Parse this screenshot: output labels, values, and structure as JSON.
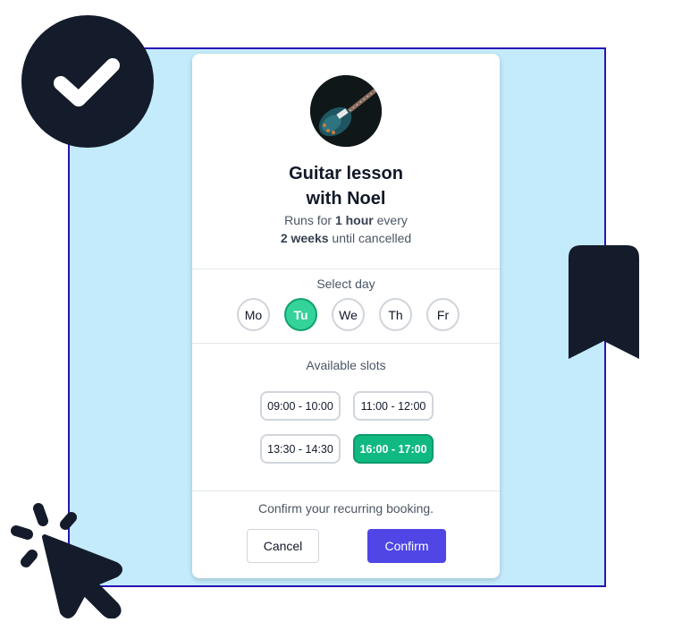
{
  "colors": {
    "frame_bg": "#c3ebfb",
    "frame_border": "#2a12b8",
    "icon_dark": "#141b2b",
    "selected_day": "#34d399",
    "selected_slot": "#10b981",
    "primary": "#4f46e5"
  },
  "decorations": {
    "badge_icon": "check-circle-icon",
    "bookmark_icon": "bookmark-icon",
    "cursor_icon": "cursor-click-icon"
  },
  "booking": {
    "avatar_alt": "guitar",
    "title_line1": "Guitar lesson",
    "title_line2": "with Noel",
    "subtitle_prefix": "Runs for ",
    "subtitle_duration": "1 hour",
    "subtitle_middle": " every",
    "subtitle_interval": "2 weeks",
    "subtitle_suffix": " until cancelled"
  },
  "day_picker": {
    "label": "Select day",
    "days": [
      {
        "label": "Mo",
        "selected": false
      },
      {
        "label": "Tu",
        "selected": true
      },
      {
        "label": "We",
        "selected": false
      },
      {
        "label": "Th",
        "selected": false
      },
      {
        "label": "Fr",
        "selected": false
      }
    ]
  },
  "slots": {
    "label": "Available slots",
    "items": [
      {
        "label": "09:00 - 10:00",
        "selected": false
      },
      {
        "label": "11:00 - 12:00",
        "selected": false
      },
      {
        "label": "13:30 - 14:30",
        "selected": false
      },
      {
        "label": "16:00 - 17:00",
        "selected": true
      }
    ]
  },
  "footer": {
    "prompt": "Confirm your recurring booking.",
    "cancel_label": "Cancel",
    "confirm_label": "Confirm"
  }
}
